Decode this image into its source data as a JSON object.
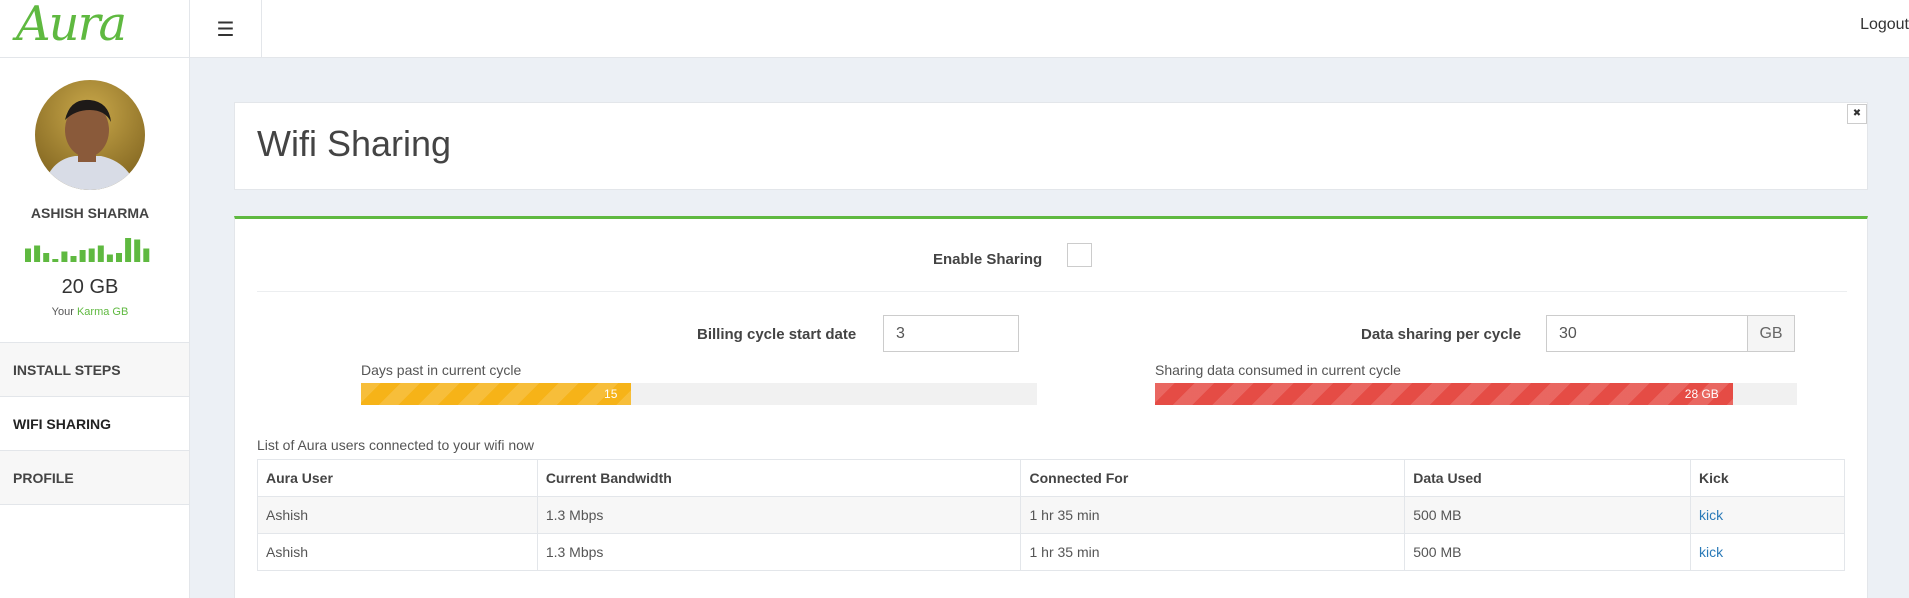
{
  "header": {
    "logo": "Aura",
    "logout_label": "Logout"
  },
  "sidebar": {
    "user_name": "ASHISH SHARMA",
    "usage_bars": [
      0.45,
      0.55,
      0.3,
      0.1,
      0.35,
      0.2,
      0.4,
      0.45,
      0.55,
      0.25,
      0.3,
      0.8,
      0.75,
      0.45
    ],
    "karma_value": "20 GB",
    "karma_prefix": "Your",
    "karma_link": "Karma GB",
    "nav": [
      {
        "label": "INSTALL STEPS"
      },
      {
        "label": "WIFI SHARING"
      },
      {
        "label": "PROFILE"
      }
    ]
  },
  "page": {
    "title": "Wifi Sharing"
  },
  "sharing": {
    "enable_label": "Enable Sharing",
    "billing_label": "Billing cycle start date",
    "billing_value": "3",
    "data_label": "Data sharing per cycle",
    "data_value": "30",
    "data_unit": "GB"
  },
  "progress": {
    "days_label": "Days past in current cycle",
    "days_value": "15",
    "days_fraction": 0.4,
    "data_label": "Sharing data consumed in current cycle",
    "data_value": "28 GB",
    "data_fraction": 0.9
  },
  "table": {
    "caption": "List of Aura users connected to your wifi now",
    "headers": [
      "Aura User",
      "Current Bandwidth",
      "Connected For",
      "Data Used",
      "Kick"
    ],
    "rows": [
      [
        "Ashish",
        "1.3 Mbps",
        "1 hr 35 min",
        "500 MB",
        "kick"
      ],
      [
        "Ashish",
        "1.3 Mbps",
        "1 hr 35 min",
        "500 MB",
        "kick"
      ]
    ]
  },
  "colors": {
    "brand": "#5fb940",
    "progress_days": "#f6b318",
    "progress_data": "#e54c45",
    "link": "#2a7ab8"
  }
}
